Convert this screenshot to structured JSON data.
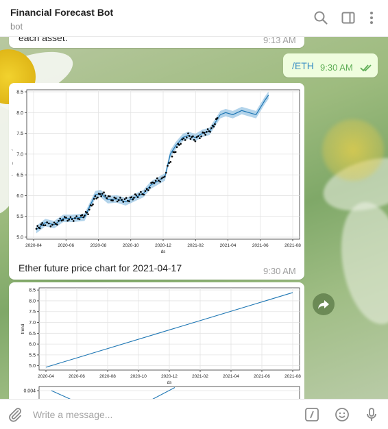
{
  "header": {
    "title": "Financial Forecast Bot",
    "subtitle": "bot",
    "icons": [
      "search-icon",
      "sidebar-toggle-icon",
      "more-vertical-icon"
    ]
  },
  "messages": [
    {
      "sender": "bot",
      "text": "each asset.",
      "time": "9:13 AM"
    },
    {
      "sender": "user",
      "text": "/ETH",
      "time": "9:30 AM",
      "status": "read"
    },
    {
      "sender": "bot",
      "caption": "Ether future price chart for 2021-04-17",
      "time": "9:30 AM"
    }
  ],
  "composer": {
    "placeholder": "Write a message...",
    "icons": [
      "attach-icon",
      "bot-commands-icon",
      "emoji-icon",
      "microphone-icon"
    ]
  },
  "colors": {
    "accent": "#5fae57",
    "forecast_line": "#1f77b4",
    "uncertainty_band": "#a6cce8"
  },
  "chart_data": [
    {
      "type": "line",
      "xlabel": "ds",
      "ylabel": "ln(stock_return)",
      "xticks": [
        "2020-04",
        "2020-06",
        "2020-08",
        "2020-10",
        "2020-12",
        "2021-02",
        "2021-04",
        "2021-06",
        "2021-08"
      ],
      "yticks": [
        "5.0",
        "5.5",
        "6.0",
        "6.5",
        "7.0",
        "7.5",
        "8.0",
        "8.5"
      ],
      "ylim": [
        5.0,
        8.5
      ],
      "grid": true,
      "series": [
        {
          "values": [
            [
              0,
              5.18
            ],
            [
              0.5,
              5.35
            ],
            [
              1,
              5.3
            ],
            [
              1.5,
              5.45
            ],
            [
              2,
              5.45
            ],
            [
              2.7,
              5.48
            ],
            [
              3,
              5.75
            ],
            [
              3.3,
              6.02
            ],
            [
              3.6,
              6.05
            ],
            [
              4,
              5.9
            ],
            [
              4.5,
              5.92
            ],
            [
              5,
              5.85
            ],
            [
              5.5,
              5.95
            ],
            [
              6,
              6.05
            ],
            [
              6.4,
              6.25
            ],
            [
              6.8,
              6.35
            ],
            [
              7.2,
              6.45
            ],
            [
              7.5,
              7.0
            ],
            [
              7.8,
              7.2
            ],
            [
              8.2,
              7.4
            ],
            [
              8.5,
              7.45
            ],
            [
              8.9,
              7.4
            ],
            [
              9.3,
              7.5
            ],
            [
              9.7,
              7.55
            ],
            [
              10,
              7.75
            ],
            [
              10.3,
              7.95
            ],
            [
              10.6,
              8.0
            ],
            [
              11,
              7.95
            ],
            [
              11.5,
              8.05
            ],
            [
              11.9,
              8.0
            ],
            [
              12.3,
              7.95
            ],
            [
              12.8,
              8.3
            ],
            [
              13,
              8.42
            ]
          ]
        },
        {
          "values": [
            [
              0,
              5.2
            ],
            [
              0.4,
              5.32
            ],
            [
              1,
              5.3
            ],
            [
              1.5,
              5.45
            ],
            [
              2,
              5.43
            ],
            [
              2.5,
              5.48
            ],
            [
              2.9,
              5.6
            ],
            [
              3.3,
              5.95
            ],
            [
              3.7,
              6.05
            ],
            [
              4.2,
              5.92
            ],
            [
              4.7,
              5.9
            ],
            [
              5.2,
              5.9
            ],
            [
              5.6,
              6.0
            ],
            [
              6.1,
              6.08
            ],
            [
              6.6,
              6.35
            ],
            [
              7.1,
              6.4
            ],
            [
              7.6,
              6.95
            ],
            [
              8.0,
              7.25
            ],
            [
              8.5,
              7.45
            ],
            [
              8.9,
              7.35
            ],
            [
              9.4,
              7.5
            ],
            [
              9.8,
              7.6
            ],
            [
              10.2,
              7.9
            ]
          ]
        }
      ]
    },
    {
      "type": "line",
      "xlabel": "ds",
      "ylabel": "trend",
      "xticks": [
        "2020-04",
        "2020-06",
        "2020-08",
        "2020-10",
        "2020-12",
        "2021-02",
        "2021-04",
        "2021-06",
        "2021-08"
      ],
      "yticks": [
        "5.0",
        "5.5",
        "6.0",
        "6.5",
        "7.0",
        "7.5",
        "8.0",
        "8.5"
      ],
      "ylim": [
        4.8,
        8.6
      ],
      "grid": true,
      "series": [
        {
          "values": [
            [
              0,
              4.93
            ],
            [
              16,
              8.38
            ]
          ]
        }
      ]
    },
    {
      "type": "line",
      "ylabel": "",
      "yticks": [
        "0.004"
      ],
      "grid": true,
      "series": [
        {
          "values": [
            [
              0,
              0.004
            ],
            [
              1,
              0.0025
            ],
            [
              2,
              0.0008
            ],
            [
              4,
              0.001
            ],
            [
              6,
              0.0045
            ]
          ]
        }
      ]
    }
  ]
}
